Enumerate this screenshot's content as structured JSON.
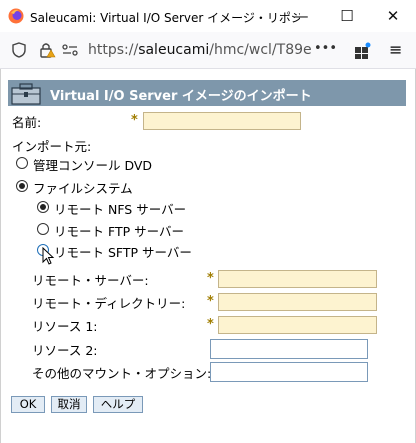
{
  "window": {
    "title": "Saleucami: Virtual I/O Server イメージ・リポジトリ...",
    "minimize_glyph": "—",
    "maximize_glyph": "☐",
    "close_glyph": "✕"
  },
  "browser": {
    "url_domain": "saleucami",
    "url_prefix": "https://",
    "url_path": "/hmc/wcl/T89e",
    "menu_glyph": "•••"
  },
  "dialog": {
    "title": "Virtual I/O Server イメージのインポート",
    "name_label": "名前:",
    "name_value": "",
    "source_label": "インポート元:",
    "options": {
      "console_dvd": "管理コンソール DVD",
      "filesystem": "ファイルシステム"
    },
    "sub_options": {
      "nfs": "リモート NFS サーバー",
      "ftp": "リモート FTP サーバー",
      "sftp": "リモート SFTP サーバー"
    },
    "selected_source": "filesystem",
    "selected_remote": "nfs",
    "fields": {
      "remote_server": "リモート・サーバー:",
      "remote_directory": "リモート・ディレクトリー:",
      "resource1": "リソース 1:",
      "resource2": "リソース 2:",
      "other_mount": "その他のマウント・オプション:"
    },
    "required_marker": "*",
    "buttons": {
      "ok": "OK",
      "cancel": "取消",
      "help": "ヘルプ"
    }
  },
  "colors": {
    "header_bg": "#7e97ab",
    "required_field_bg": "#fdf3d0",
    "button_bg": "#e3ecf5"
  }
}
